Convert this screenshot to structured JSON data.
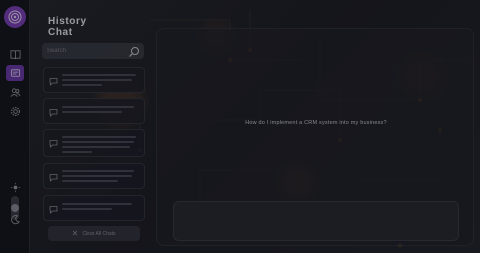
{
  "app": {
    "accent_color": "#7b3fb8",
    "active_color": "#6a3aa8"
  },
  "rail": {
    "logo_icon": "brain-target-icon",
    "items": [
      {
        "icon": "book-icon",
        "active": false
      },
      {
        "icon": "chat-history-icon",
        "active": true
      },
      {
        "icon": "users-icon",
        "active": false
      },
      {
        "icon": "gear-icon",
        "active": false
      }
    ],
    "theme": {
      "light_icon": "sun-icon",
      "dark_icon": "moon-icon"
    }
  },
  "history": {
    "title": "History Chat",
    "search": {
      "placeholder": "Search",
      "value": ""
    },
    "chats": [
      {
        "icon": "chat-bubble-icon"
      },
      {
        "icon": "chat-bubble-icon"
      },
      {
        "icon": "chat-bubble-icon"
      },
      {
        "icon": "chat-bubble-icon"
      },
      {
        "icon": "chat-bubble-icon"
      }
    ],
    "clear_label": "Clear All Chats"
  },
  "main": {
    "message": "How do I implement a CRM system into my business?",
    "composer": {
      "placeholder": "",
      "value": ""
    }
  }
}
